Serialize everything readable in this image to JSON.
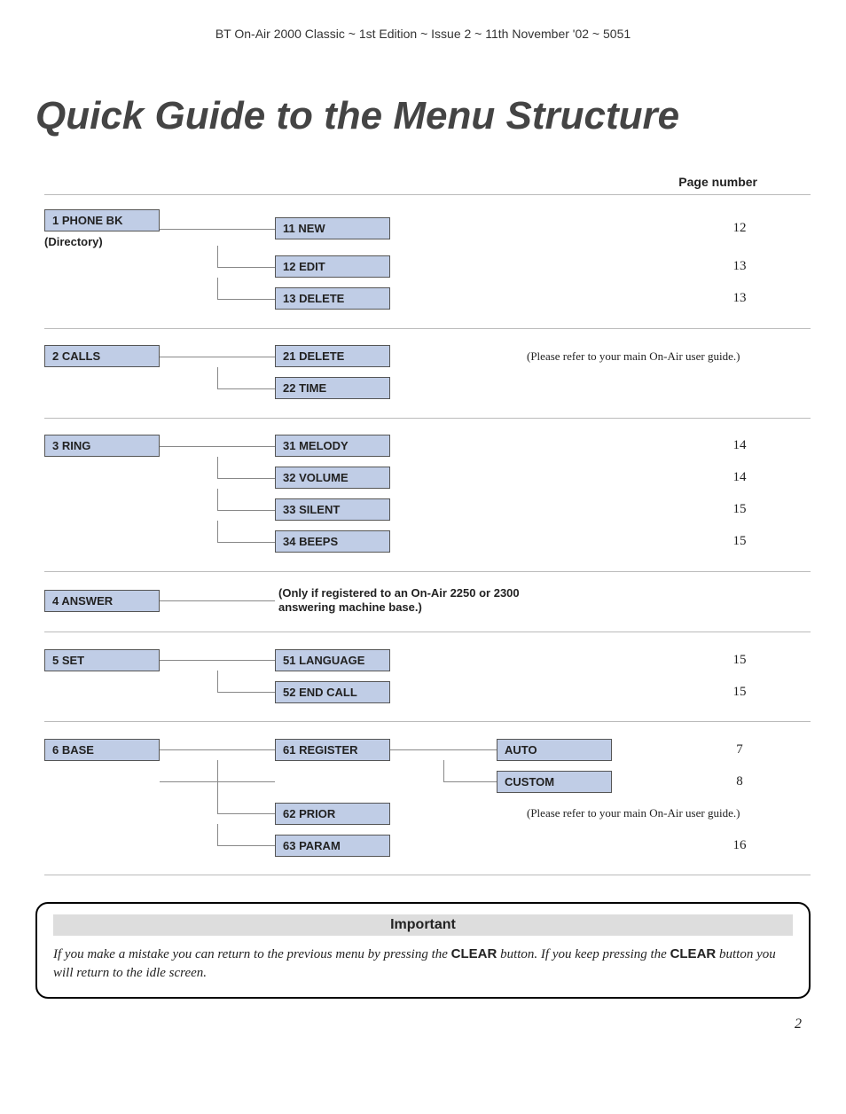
{
  "header": "BT On-Air 2000 Classic ~ 1st Edition ~ Issue 2 ~ 11th November '02 ~ 5051",
  "title": "Quick Guide to the Menu Structure",
  "page_number_header": "Page number",
  "groups": [
    {
      "parent": "1 PHONE BK",
      "sub_label": "(Directory)",
      "children": [
        {
          "label": "11 NEW",
          "page": "12"
        },
        {
          "label": "12 EDIT",
          "page": "13"
        },
        {
          "label": "13 DELETE",
          "page": "13"
        }
      ]
    },
    {
      "parent": "2 CALLS",
      "right_note_top": "(Please refer to your main On-Air user guide.)",
      "children": [
        {
          "label": "21 DELETE"
        },
        {
          "label": "22 TIME"
        }
      ]
    },
    {
      "parent": "3 RING",
      "children": [
        {
          "label": "31 MELODY",
          "page": "14"
        },
        {
          "label": "32 VOLUME",
          "page": "14"
        },
        {
          "label": "33 SILENT",
          "page": "15"
        },
        {
          "label": "34 BEEPS",
          "page": "15"
        }
      ]
    },
    {
      "parent": "4 ANSWER",
      "note": "(Only if registered to an On-Air 2250 or 2300 answering machine base.)"
    },
    {
      "parent": "5 SET",
      "children": [
        {
          "label": "51 LANGUAGE",
          "page": "15"
        },
        {
          "label": "52 END CALL",
          "page": "15"
        }
      ]
    },
    {
      "parent": "6 BASE",
      "children": [
        {
          "label": "61 REGISTER",
          "grandchildren": [
            {
              "label": "AUTO",
              "page": "7"
            },
            {
              "label": "CUSTOM",
              "page": "8"
            }
          ]
        },
        {
          "label": "62 PRIOR",
          "right_note": "(Please refer to your main On-Air user guide.)"
        },
        {
          "label": "63 PARAM",
          "page": "16"
        }
      ]
    }
  ],
  "important": {
    "title": "Important",
    "body_prefix": "If you make a mistake you can return to the previous menu by pressing the ",
    "kw1": "CLEAR",
    "body_mid": " button. If you keep pressing the ",
    "kw2": "CLEAR",
    "body_suffix": " button you will return to the idle screen."
  },
  "page_number": "2"
}
